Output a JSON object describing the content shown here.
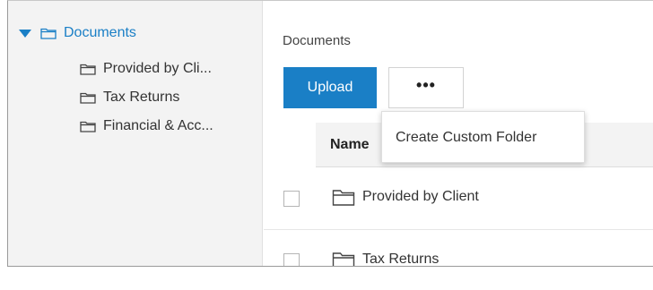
{
  "sidebar": {
    "root": {
      "label": "Documents",
      "icon": "folder-icon",
      "expanded": true
    },
    "items": [
      {
        "label": "Provided by Cli...",
        "icon": "folder-icon"
      },
      {
        "label": "Tax Returns",
        "icon": "folder-icon"
      },
      {
        "label": "Financial & Acc...",
        "icon": "folder-icon"
      }
    ]
  },
  "main": {
    "breadcrumb": "Documents",
    "toolbar": {
      "upload_label": "Upload",
      "more_label": "•••"
    },
    "menu": {
      "items": [
        {
          "label": "Create Custom Folder"
        }
      ]
    },
    "table": {
      "columns": [
        "Name"
      ],
      "rows": [
        {
          "name": "Provided by Client",
          "icon": "folder-icon",
          "checked": false
        },
        {
          "name": "Tax Returns",
          "icon": "folder-icon",
          "checked": false
        }
      ]
    }
  },
  "colors": {
    "accent": "#1a7fc6",
    "sidebar_bg": "#f3f3f3",
    "header_bg": "#f3f3f3",
    "text": "#333333"
  }
}
